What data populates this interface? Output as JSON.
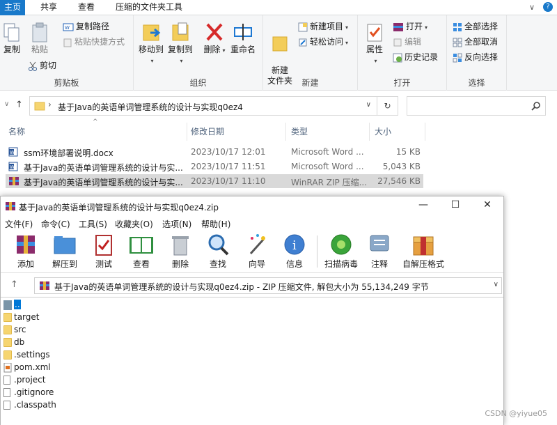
{
  "explorer": {
    "tabs": [
      {
        "label": "主页",
        "active": true
      },
      {
        "label": "共享"
      },
      {
        "label": "查看"
      },
      {
        "label": "压缩的文件夹工具"
      }
    ],
    "ribbon": {
      "clipboard": {
        "label": "剪贴板",
        "copy": "复制",
        "paste": "粘贴",
        "copy_path": "复制路径",
        "paste_shortcut": "粘贴快捷方式",
        "cut": "剪切"
      },
      "organize": {
        "label": "组织",
        "move_to": "移动到",
        "copy_to": "复制到",
        "delete": "删除",
        "rename": "重命名"
      },
      "new": {
        "label": "新建",
        "new_folder": "新建\n文件夹",
        "new_item": "新建项目",
        "easy_access": "轻松访问"
      },
      "open": {
        "label": "打开",
        "properties": "属性",
        "open": "打开",
        "edit": "编辑",
        "history": "历史记录"
      },
      "select": {
        "label": "选择",
        "select_all": "全部选择",
        "select_none": "全部取消",
        "invert": "反向选择"
      }
    },
    "address": {
      "path": "基于Java的英语单词管理系统的设计与实现q0ez4"
    },
    "columns": {
      "name": "名称",
      "date": "修改日期",
      "type": "类型",
      "size": "大小"
    },
    "files": [
      {
        "name": "ssm环境部署说明.docx",
        "date": "2023/10/17 12:01",
        "type": "Microsoft Word ...",
        "size": "15 KB",
        "icon": "word-icon"
      },
      {
        "name": "基于Java的英语单词管理系统的设计与实...",
        "date": "2023/10/17 11:51",
        "type": "Microsoft Word ...",
        "size": "5,043 KB",
        "icon": "word-icon"
      },
      {
        "name": "基于Java的英语单词管理系统的设计与实...",
        "date": "2023/10/17 11:10",
        "type": "WinRAR ZIP 压缩...",
        "size": "27,546 KB",
        "icon": "winrar-icon",
        "selected": true
      }
    ]
  },
  "winrar": {
    "title": "基于Java的英语单词管理系统的设计与实现q0ez4.zip",
    "menu": [
      "文件(F)",
      "命令(C)",
      "工具(S)",
      "收藏夹(O)",
      "选项(N)",
      "帮助(H)"
    ],
    "toolbar": [
      "添加",
      "解压到",
      "测试",
      "查看",
      "删除",
      "查找",
      "向导",
      "信息",
      "扫描病毒",
      "注释",
      "自解压格式"
    ],
    "path": "基于Java的英语单词管理系统的设计与实现q0ez4.zip - ZIP 压缩文件, 解包大小为 55,134,249 字节",
    "items": [
      {
        "name": "..",
        "kind": "up"
      },
      {
        "name": "target",
        "kind": "folder"
      },
      {
        "name": "src",
        "kind": "folder"
      },
      {
        "name": "db",
        "kind": "folder"
      },
      {
        "name": ".settings",
        "kind": "folder"
      },
      {
        "name": "pom.xml",
        "kind": "xml"
      },
      {
        "name": ".project",
        "kind": "file"
      },
      {
        "name": ".gitignore",
        "kind": "file"
      },
      {
        "name": ".classpath",
        "kind": "file"
      }
    ]
  },
  "watermark": "CSDN @yiyue05",
  "colors": {
    "accent": "#1979ca",
    "selection": "#d9d9d9",
    "rar_selection": "#0078d7"
  }
}
